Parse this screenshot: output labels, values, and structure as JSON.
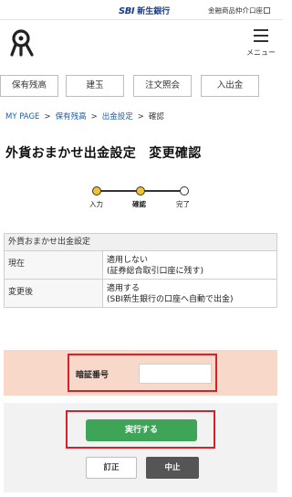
{
  "topbar": {
    "logo_mark": "SBI",
    "logo_bank": "新生銀行",
    "link": "金融商品仲介口座"
  },
  "header": {
    "menu_label": "メニュー"
  },
  "tabs": [
    {
      "label": "保有残高"
    },
    {
      "label": "建玉"
    },
    {
      "label": "注文照会"
    },
    {
      "label": "入出金"
    }
  ],
  "breadcrumb": {
    "items": [
      "MY PAGE",
      "保有残高",
      "出金設定",
      "確認"
    ],
    "separator": ">"
  },
  "page_title": "外貨おまかせ出金設定　変更確認",
  "steps": [
    {
      "label": "入力"
    },
    {
      "label": "確認"
    },
    {
      "label": "完了"
    }
  ],
  "settings": {
    "caption": "外貨おまかせ出金設定",
    "rows": [
      {
        "key": "現在",
        "value_line1": "適用しない",
        "value_line2": "(証券総合取引口座に残す)"
      },
      {
        "key": "変更後",
        "value_line1": "適用する",
        "value_line2": "(SBI新生銀行の口座へ自動で出金)"
      }
    ]
  },
  "pin": {
    "label": "暗証番号",
    "value": "",
    "placeholder": ""
  },
  "actions": {
    "execute_label": "実行する",
    "fix_label": "訂正",
    "stop_label": "中止"
  },
  "colors": {
    "accent_green": "#3ea457",
    "highlight_red": "#d9202a",
    "pin_bg": "#f8d8c8",
    "step_yellow": "#f2c230",
    "link_blue": "#1a5fb4"
  }
}
